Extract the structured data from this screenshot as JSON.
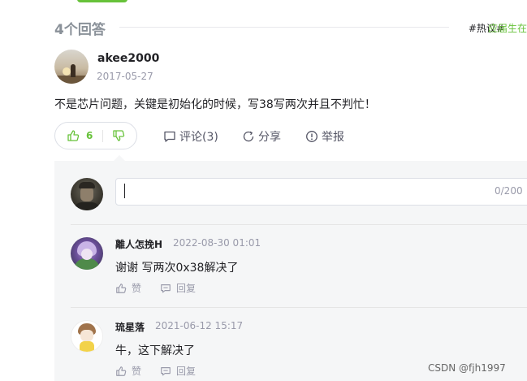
{
  "answers": {
    "title": "4个回答",
    "topic_tag": "#热议#",
    "topic_extra": "应届生在"
  },
  "answer": {
    "username": "akee2000",
    "date": "2017-05-27",
    "body": "不是芯片问题，关键是初始化的时候，写38写两次并且不判忙！",
    "likes": "6",
    "actions": {
      "comment": "评论(3)",
      "share": "分享",
      "report": "举报"
    }
  },
  "comment_box": {
    "placeholder": "",
    "char_count": "0/200"
  },
  "comments": [
    {
      "username": "離人怎挽H",
      "time": "2022-08-30 01:01",
      "text": "谢谢 写两次0x38解决了",
      "like_label": "赞",
      "reply_label": "回复"
    },
    {
      "username": "琉星落",
      "time": "2021-06-12 15:17",
      "text": "牛，这下解决了",
      "like_label": "赞",
      "reply_label": "回复"
    }
  ],
  "watermark": "CSDN @fjh1997",
  "colors": {
    "accent": "#67c23a",
    "muted": "#999aaa",
    "panel_bg": "#f5f6f7"
  }
}
